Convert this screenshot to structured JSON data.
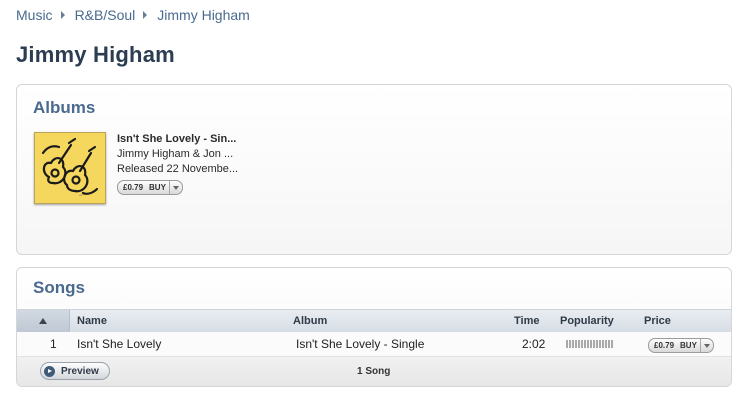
{
  "breadcrumb": [
    "Music",
    "R&B/Soul",
    "Jimmy Higham"
  ],
  "page_title": "Jimmy Higham",
  "albums": {
    "heading": "Albums",
    "items": [
      {
        "title": "Isn't She Lovely - Sin...",
        "artist": "Jimmy Higham & Jon ...",
        "released": "Released 22 Novembe...",
        "price": "£0.79",
        "buy_label": "BUY"
      }
    ]
  },
  "songs": {
    "heading": "Songs",
    "columns": [
      "Name",
      "Album",
      "Time",
      "Popularity",
      "Price"
    ],
    "rows": [
      {
        "index": "1",
        "name": "Isn't She Lovely",
        "album": "Isn't She Lovely - Single",
        "time": "2:02",
        "popularity": 0,
        "price": "£0.79",
        "buy_label": "BUY"
      }
    ],
    "preview_label": "Preview",
    "count_label": "1 Song"
  },
  "colors": {
    "link": "#4a6a8e",
    "title": "#2c3c51",
    "album_art": "#f3cf48"
  }
}
